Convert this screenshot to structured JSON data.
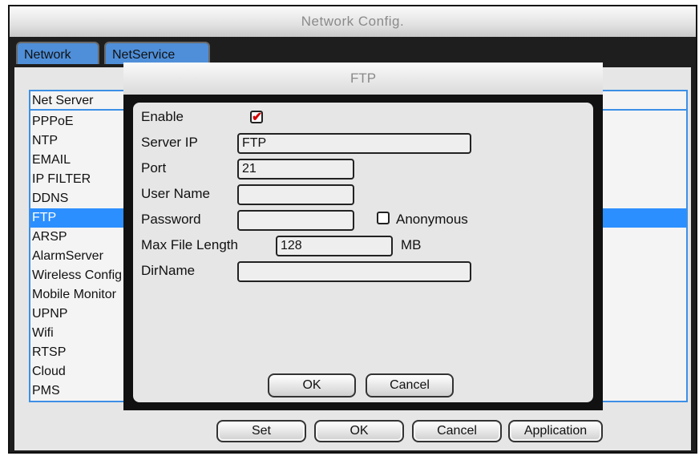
{
  "window": {
    "title": "Network Config."
  },
  "tabs": [
    {
      "label": "Network"
    },
    {
      "label": "NetService"
    }
  ],
  "table": {
    "header": "Net Server",
    "rows": [
      "PPPoE",
      "NTP",
      "EMAIL",
      "IP FILTER",
      "DDNS",
      "FTP",
      "ARSP",
      "AlarmServer",
      "Wireless Config",
      "Mobile Monitor",
      "UPNP",
      "Wifi",
      "RTSP",
      "Cloud",
      "PMS"
    ],
    "selected_index": 5
  },
  "buttons": {
    "set": "Set",
    "ok": "OK",
    "cancel": "Cancel",
    "application": "Application"
  },
  "dialog": {
    "title": "FTP",
    "enable_label": "Enable",
    "enable_checked": true,
    "server_ip_label": "Server IP",
    "server_ip_value": "FTP",
    "port_label": "Port",
    "port_value": "21",
    "user_name_label": "User Name",
    "user_name_value": "",
    "password_label": "Password",
    "password_value": "",
    "anonymous_label": "Anonymous",
    "anonymous_checked": false,
    "max_file_length_label": "Max File Length",
    "max_file_length_value": "128",
    "max_file_length_unit": "MB",
    "dirname_label": "DirName",
    "dirname_value": "",
    "ok_label": "OK",
    "cancel_label": "Cancel"
  },
  "colors": {
    "selection": "#2c8fff",
    "border_blue": "#3c8fe6",
    "check_red": "#d60000"
  }
}
